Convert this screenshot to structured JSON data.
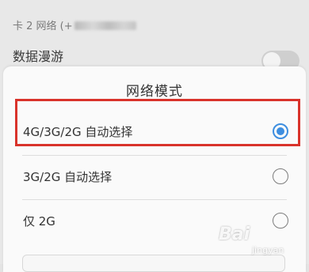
{
  "background": {
    "sim_header": "卡 2 网络 (+",
    "roaming_label": "数据漫游",
    "roaming_enabled": false
  },
  "dialog": {
    "title": "网络模式",
    "options": [
      {
        "label": "4G/3G/2G 自动选择",
        "selected": true
      },
      {
        "label": "3G/2G 自动选择",
        "selected": false
      },
      {
        "label": "仅 2G",
        "selected": false
      }
    ]
  },
  "watermark": {
    "brand": "Bai",
    "sub": "jingyan"
  },
  "colors": {
    "accent": "#3d8ee0",
    "highlight": "#d9332b"
  }
}
